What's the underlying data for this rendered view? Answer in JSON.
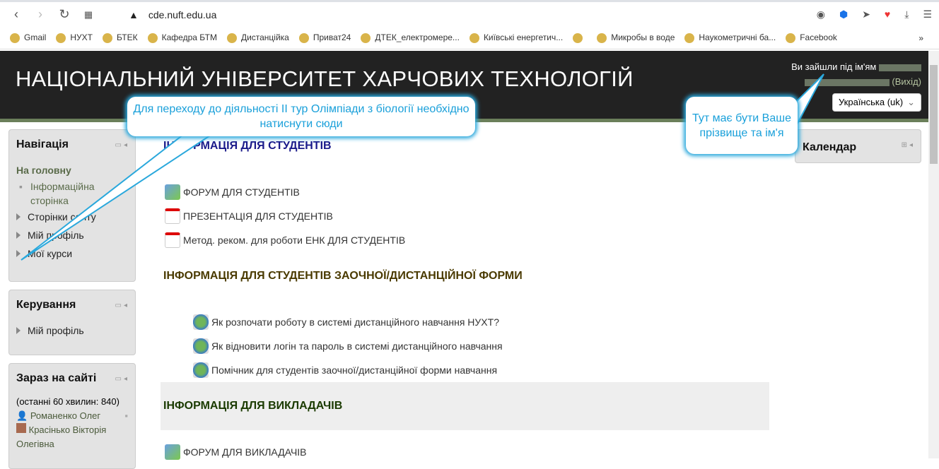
{
  "browser": {
    "url": "cde.nuft.edu.ua",
    "bookmarks": [
      "Gmail",
      "НУХТ",
      "БТЕК",
      "Кафедра БТМ",
      "Дистанційка",
      "Приват24",
      "ДТЕК_електромере...",
      "Київські енергетич...",
      "",
      "Микробы в воде",
      "Наукометричні ба...",
      "Facebook"
    ]
  },
  "header": {
    "title": "НАЦІОНАЛЬНИЙ УНІВЕРСИТЕТ ХАРЧОВИХ ТЕХНОЛОГІЙ",
    "login_text": "Ви зайшли під ім'ям",
    "logout": "(Вихід)",
    "language": "Українська (uk)"
  },
  "navigation": {
    "title": "Навігація",
    "home": "На головну",
    "items": [
      "Інформаційна сторінка",
      "Сторінки сайту",
      "Мій профіль",
      "Мої курси"
    ]
  },
  "admin": {
    "title": "Керування",
    "items": [
      "Мій профіль"
    ]
  },
  "online": {
    "title": "Зараз на сайті",
    "summary": "(останні 60 хвилин: 840)",
    "users": [
      "Романенко Олег",
      "Красінько Вікторія Олегівна"
    ]
  },
  "calendar": {
    "title": "Календар"
  },
  "main": {
    "sections": [
      {
        "title": "ІНФОРМАЦІЯ ДЛЯ СТУДЕНТІВ",
        "color": "#1a1a8a",
        "items": [
          {
            "icon": "forum",
            "label": "ФОРУМ ДЛЯ СТУДЕНТІВ"
          },
          {
            "icon": "pdf",
            "label": "ПРЕЗЕНТАЦІЯ ДЛЯ СТУДЕНТІВ"
          },
          {
            "icon": "pdf",
            "label": "Метод. реком. для роботи ЕНК ДЛЯ СТУДЕНТІВ"
          }
        ]
      },
      {
        "title": "ІНФОРМАЦІЯ ДЛЯ СТУДЕНТІВ  ЗАОЧНОЇ/ДИСТАНЦІЙНОЇ ФОРМИ",
        "color": "#4a3a00",
        "items": [
          {
            "icon": "url",
            "label": "Як розпочати роботу в системі дистанційного навчання НУХТ?"
          },
          {
            "icon": "url",
            "label": "Як відновити логін та пароль в системі дистанційного навчання"
          },
          {
            "icon": "url",
            "label": "Помічник для студентів заочної/дистанційної форми навчання"
          }
        ]
      },
      {
        "title": "ІНФОРМАЦІЯ ДЛЯ ВИКЛАДАЧІВ",
        "color": "#1a3a00",
        "items": [
          {
            "icon": "forum",
            "label": "ФОРУМ ДЛЯ ВИКЛАДАЧІВ"
          }
        ]
      }
    ]
  },
  "callouts": [
    "Для переходу до діяльності ІІ тур Олімпіади з біології необхідно натиснути сюди",
    "Тут має бути Ваше прізвище та ім'я"
  ]
}
